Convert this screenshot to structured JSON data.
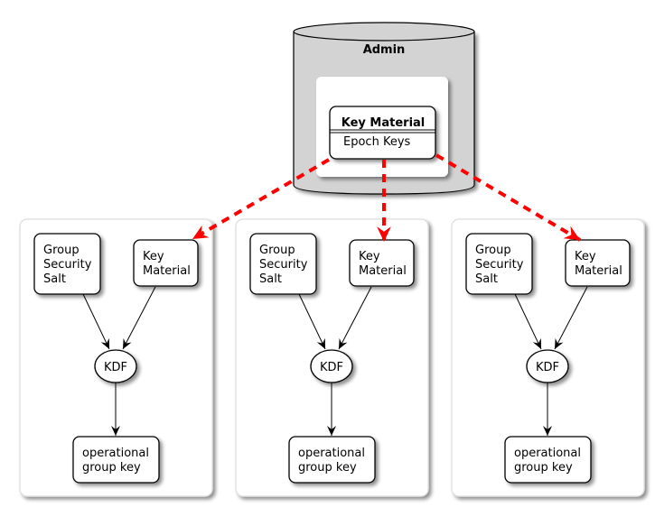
{
  "admin": {
    "title": "Admin",
    "key_material_class": {
      "name": "Key Material",
      "field": "Epoch Keys"
    }
  },
  "groups": [
    {
      "salt_lines": [
        "Group",
        "Security",
        "Salt"
      ],
      "key_lines": [
        "Key",
        "Material"
      ],
      "kdf": "KDF",
      "output_lines": [
        "operational",
        "group key"
      ]
    },
    {
      "salt_lines": [
        "Group",
        "Security",
        "Salt"
      ],
      "key_lines": [
        "Key",
        "Material"
      ],
      "kdf": "KDF",
      "output_lines": [
        "operational",
        "group key"
      ]
    },
    {
      "salt_lines": [
        "Group",
        "Security",
        "Salt"
      ],
      "key_lines": [
        "Key",
        "Material"
      ],
      "kdf": "KDF",
      "output_lines": [
        "operational",
        "group key"
      ]
    }
  ],
  "colors": {
    "database_fill": "#d3d3d3",
    "distribution_arrow": "#ff0000",
    "node_stroke": "#000000",
    "frame_stroke": "#dddddd"
  }
}
